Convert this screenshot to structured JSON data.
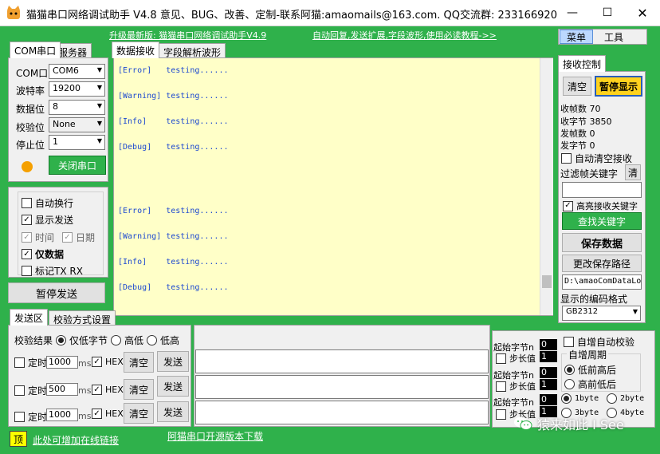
{
  "titlebar": {
    "title": "猫猫串口网络调试助手 V4.8 意见、BUG、改善、定制-联系阿猫:amaomails@163.com. QQ交流群: 233166920"
  },
  "top_links": {
    "upgrade": "升级最新版: 猫猫串口网络调试助手V4.9",
    "auto_reply": "自动回复,发送扩展,字段波形,使用必读教程->>"
  },
  "top_tabs": {
    "menu": "菜单",
    "tools": "工具"
  },
  "left_tabs": {
    "com": "COM串口",
    "server": "服务器"
  },
  "com": {
    "port_label": "COM口",
    "port_value": "COM6",
    "baud_label": "波特率",
    "baud_value": "19200",
    "data_label": "数据位",
    "data_value": "8",
    "parity_label": "校验位",
    "parity_value": "None",
    "stop_label": "停止位",
    "stop_value": "1",
    "close_button": "关闭串口",
    "status_color": "#f5a000"
  },
  "options": {
    "auto_wrap": "自动换行",
    "show_send": "显示发送",
    "time": "时间",
    "date": "日期",
    "data_only": "仅数据",
    "mark_txrx": "标记TX RX"
  },
  "pause_send": "暂停发送",
  "recv_tabs": {
    "data": "数据接收",
    "field": "字段解析波形"
  },
  "recv_lines": [
    {
      "tag": "[Error]",
      "msg": "testing......"
    },
    {
      "tag": "[Warning]",
      "msg": "testing......"
    },
    {
      "tag": "[Info]",
      "msg": "testing......"
    },
    {
      "tag": "[Debug]",
      "msg": "testing......"
    },
    {
      "tag": "[Error]",
      "msg": "testing......"
    },
    {
      "tag": "[Warning]",
      "msg": "testing......"
    },
    {
      "tag": "[Info]",
      "msg": "testing......"
    },
    {
      "tag": "[Debug]",
      "msg": "testing......"
    }
  ],
  "recv_ctrl": {
    "tab": "接收控制",
    "clear": "清空",
    "pause": "暂停显示",
    "rx_frames": "收帧数 70",
    "rx_bytes": "收字节 3850",
    "tx_frames": "发帧数 0",
    "tx_bytes": "发字节 0",
    "auto_clear": "自动清空接收",
    "filter": "过滤帧关键字",
    "filter_clear": "清",
    "highlight": "高亮接收关键字",
    "find_keyword": "查找关键字",
    "save_data": "保存数据",
    "change_path": "更改保存路径",
    "path": "D:\\amaoComDataLo",
    "encoding_label": "显示的编码格式",
    "encoding": "GB2312"
  },
  "send_tabs": {
    "send": "发送区",
    "checksum": "校验方式设置"
  },
  "checksum": {
    "label": "校验结果",
    "low_first": "仅低字节",
    "high": "高低",
    "low": "低高"
  },
  "send_rows": [
    {
      "timer": "定时",
      "ms_value": "1000",
      "ms": "ms",
      "hex": "HEX",
      "clear": "清空",
      "send": "发送"
    },
    {
      "timer": "定时",
      "ms_value": "500",
      "ms": "ms",
      "hex": "HEX",
      "clear": "清空",
      "send": "发送"
    },
    {
      "timer": "定时",
      "ms_value": "1000",
      "ms": "ms",
      "hex": "HEX",
      "clear": "清空",
      "send": "发送"
    }
  ],
  "increment": {
    "start_byte": "起始字节n",
    "step": "步长值",
    "start_value": "0",
    "step_value": "1",
    "auto_check": "自增自动校验",
    "period": "自增周期",
    "high_first": "低前高后",
    "low_first": "高前低后",
    "b1": "1byte",
    "b2": "2byte",
    "b3": "3byte",
    "b4": "4byte"
  },
  "bottom": {
    "top_badge": "顶",
    "online_link": "此处可增加在线链接",
    "open_source": "阿猫串口开源版本下载"
  },
  "watermark": "猿来如此 I See"
}
